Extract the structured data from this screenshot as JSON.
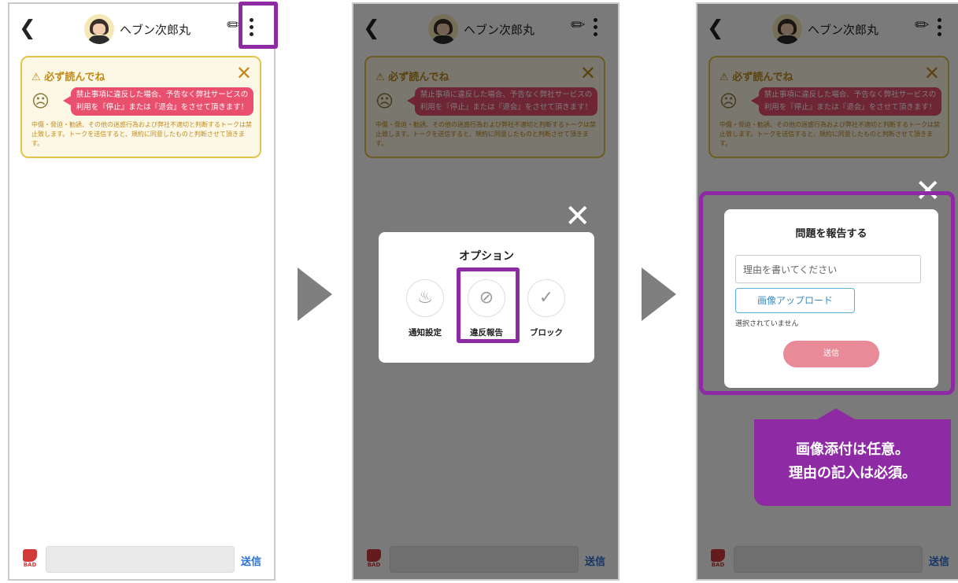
{
  "header": {
    "title": "ヘブン次郎丸"
  },
  "notice": {
    "title": "必ず読んでね",
    "bubble_line1": "禁止事項に違反した場合、予告なく弊社サービスの",
    "bubble_line2": "利用を『停止』または『退会』をさせて頂きます！",
    "body": "中傷・脅迫・勧誘、その他の迷惑行為および弊社不適切と判断するトークは禁止致します。トークを送信すると、規約に同意したものと判断させて頂きます。"
  },
  "footer": {
    "bad_label": "BAD",
    "send_label": "送信"
  },
  "options": {
    "title": "オプション",
    "items": [
      {
        "label": "通知設定",
        "icon": "bell-icon"
      },
      {
        "label": "違反報告",
        "icon": "ban-icon"
      },
      {
        "label": "ブロック",
        "icon": "shield-check-icon"
      }
    ]
  },
  "report": {
    "title": "問題を報告する",
    "reason_placeholder": "理由を書いてください",
    "upload_label": "画像アップロード",
    "file_status": "選択されていません",
    "send_label": "送信"
  },
  "callout": {
    "line1": "画像添付は任意。",
    "line2": "理由の記入は必須。"
  },
  "colors": {
    "highlight": "#8e2aa4",
    "send_blue": "#2b6fd6",
    "notice_border": "#e6c34a",
    "bubble": "#e9506e",
    "report_send": "#e88a97"
  }
}
